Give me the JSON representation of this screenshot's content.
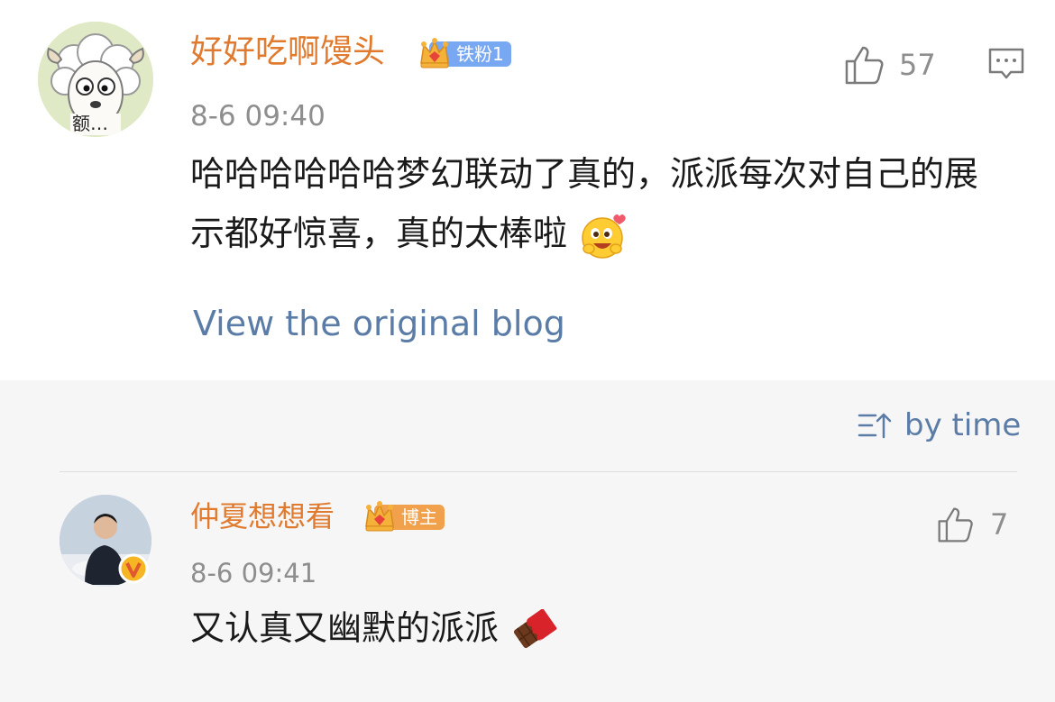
{
  "comment": {
    "username": "好好吃啊馒头",
    "badge_label": "铁粉1",
    "avatar_caption": "额…",
    "timestamp": "8-6 09:40",
    "text": "哈哈哈哈哈哈梦幻联动了真的，派派每次对自己的展示都好惊喜，真的太棒啦",
    "emoji": "grinning-hug-emoji",
    "like_count": "57"
  },
  "view_original_label": "View the original blog",
  "sort": {
    "label": "by time"
  },
  "reply": {
    "username": "仲夏想想看",
    "badge_label": "博主",
    "timestamp": "8-6 09:41",
    "text": "又认真又幽默的派派",
    "emoji": "chocolate-bar-emoji",
    "like_count": "7"
  },
  "colors": {
    "username": "#e07a2f",
    "link": "#5a7ca6",
    "muted": "#8e8e8e",
    "fan_badge": "#78a8f2",
    "host_badge": "#f1a14b"
  }
}
